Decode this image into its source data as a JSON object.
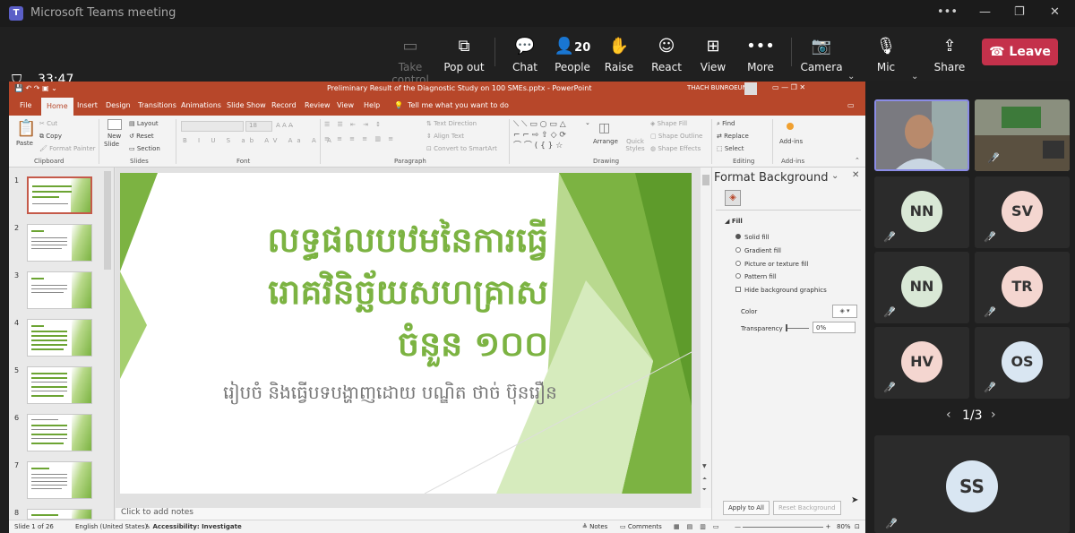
{
  "window": {
    "title": "Microsoft Teams meeting",
    "more": "•••",
    "minimize": "—",
    "restore": "❐",
    "close": "✕"
  },
  "toolbar": {
    "timer": "33:47",
    "take_control": "Take control",
    "pop_out": "Pop out",
    "chat": "Chat",
    "people": "People",
    "people_count": "20",
    "raise": "Raise",
    "react": "React",
    "view": "View",
    "more": "More",
    "camera": "Camera",
    "mic": "Mic",
    "share": "Share",
    "leave": "Leave"
  },
  "ppt": {
    "doc_title": "Preliminary Result of the Diagnostic Study on 100 SMEs.pptx  -  PowerPoint",
    "user": "THACH BUNROEUN",
    "tabs": [
      "File",
      "Home",
      "Insert",
      "Design",
      "Transitions",
      "Animations",
      "Slide Show",
      "Record",
      "Review",
      "View",
      "Help"
    ],
    "tell_me": "Tell me what you want to do",
    "ribbon": {
      "paste": "Paste",
      "cut": "Cut",
      "copy": "Copy",
      "format_painter": "Format Painter",
      "clipboard": "Clipboard",
      "new_slide": "New",
      "new_slide2": "Slide",
      "layout": "Layout",
      "reset": "Reset",
      "section": "Section",
      "slides": "Slides",
      "font_size": "18",
      "font": "Font",
      "text_direction": "Text Direction",
      "align_text": "Align Text",
      "convert_smartart": "Convert to SmartArt",
      "paragraph": "Paragraph",
      "arrange": "Arrange",
      "quick_styles": "Quick Styles",
      "shape_fill": "Shape Fill",
      "shape_outline": "Shape Outline",
      "shape_effects": "Shape Effects",
      "drawing": "Drawing",
      "find": "Find",
      "replace": "Replace",
      "select": "Select",
      "editing": "Editing",
      "add_ins": "Add-ins",
      "add_ins_group": "Add-ins"
    },
    "slide_numbers": [
      "1",
      "2",
      "3",
      "4",
      "5",
      "6",
      "7",
      "8"
    ],
    "slide": {
      "title_lines": [
        "លទ្ធផលបឋមនៃការធ្វើ",
        "រោគវិនិច្ឆ័យសហគ្រាស",
        "ចំនួន ១០០"
      ],
      "subtitle": "រៀបចំ និងធ្វើបទបង្ហាញដោយ បណ្ឌិត ថាច់ ប៊ុនរឿន"
    },
    "notes": "Click to add notes",
    "format_bg": {
      "title": "Format Background",
      "fill": "Fill",
      "options": [
        "Solid fill",
        "Gradient fill",
        "Picture or texture fill",
        "Pattern fill"
      ],
      "hide_graphics": "Hide background graphics",
      "color": "Color",
      "transparency": "Transparency",
      "transparency_value": "0%",
      "apply_all": "Apply to All",
      "reset_bg": "Reset Background"
    },
    "status": {
      "slide_of": "Slide 1 of 26",
      "language": "English (United States)",
      "accessibility": "Accessibility: Investigate",
      "notes": "Notes",
      "comments": "Comments",
      "zoom": "80%"
    }
  },
  "participants": {
    "tiles": [
      {
        "initials": "NN",
        "color": "#d9e8d6"
      },
      {
        "initials": "SV",
        "color": "#f4d6d0"
      },
      {
        "initials": "NN",
        "color": "#d9e8d6"
      },
      {
        "initials": "TR",
        "color": "#f4d6d0"
      },
      {
        "initials": "HV",
        "color": "#f4d6d0"
      },
      {
        "initials": "OS",
        "color": "#d9e6f2"
      }
    ],
    "pager": "1/3",
    "bottom": {
      "initials": "SS",
      "color": "#d9e6f2"
    }
  }
}
